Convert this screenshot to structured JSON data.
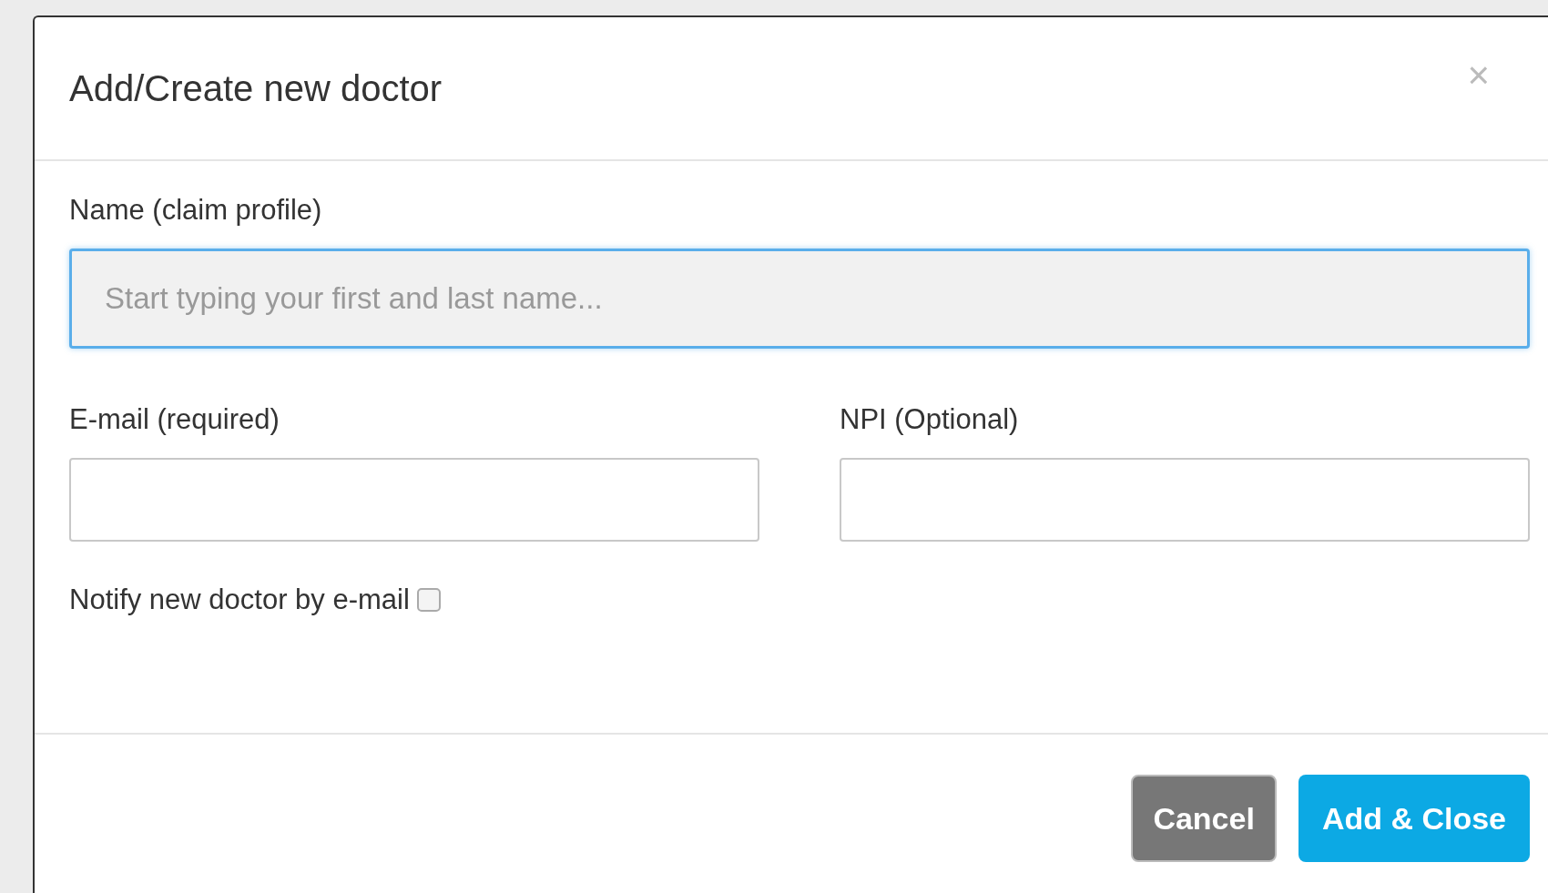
{
  "dialog": {
    "title": "Add/Create new doctor",
    "close": "×"
  },
  "fields": [
    {
      "label": "Name (claim profile)",
      "placeholder": "Start typing your first and last name...",
      "focused": true
    },
    {
      "label": "E-mail (required)",
      "focused": false
    },
    {
      "label": "NPI (Optional)",
      "focused": false
    }
  ],
  "notify": {
    "label": "Notify new doctor by e-mail",
    "checked": false
  },
  "buttons": [
    {
      "label": "Cancel",
      "kind": "secondary"
    },
    {
      "label": "Add & Close",
      "kind": "primary"
    }
  ]
}
